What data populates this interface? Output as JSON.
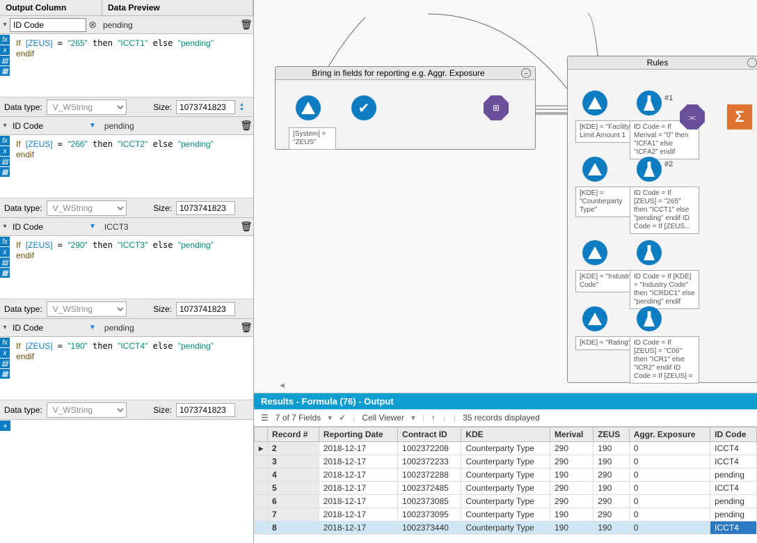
{
  "left": {
    "headers": {
      "a": "Output Column",
      "b": "Data Preview"
    },
    "blocks": [
      {
        "out": "ID Code",
        "preview": "pending",
        "zeus": "265",
        "icct": "ICCT1",
        "dt": "V_WString",
        "size": "1073741823",
        "clearX": true,
        "spin": true
      },
      {
        "out": "ID Code",
        "preview": "pending",
        "zeus": "266",
        "icct": "ICCT2",
        "dt": "V_WString",
        "size": "1073741823",
        "dd": true
      },
      {
        "out": "ID Code",
        "preview": "ICCT3",
        "zeus": "290",
        "icct": "ICCT3",
        "dt": "V_WString",
        "size": "1073741823",
        "dd": true
      },
      {
        "out": "ID Code",
        "preview": "pending",
        "zeus": "190",
        "icct": "ICCT4",
        "dt": "V_WString",
        "size": "1073741823",
        "dd": true
      }
    ],
    "labels": {
      "datatype": "Data type:",
      "size": "Size:"
    },
    "code": {
      "if": "If",
      "zeus": "[ZEUS]",
      "eq": " = ",
      "then": " then ",
      "else_": " else ",
      "pending": "\"pending\"",
      "endif": "endif"
    }
  },
  "canvas": {
    "box1": {
      "title": "Bring in fields for reporting e.g. Aggr. Exposure"
    },
    "box2": {
      "title": "Rules"
    },
    "annot_system": "[System] = \"ZEUS\"",
    "annots": [
      {
        "k": "[KDE] = \"Facility Limit Amount 1",
        "f": "ID Code = If Merival = \"0\" then \"ICFA1\" else \"ICFA2\" endif",
        "num": "#1"
      },
      {
        "k": "[KDE] = \"Counterparty Type\"",
        "f": "ID Code = If [ZEUS] = \"265\" then \"ICCT1\" else \"pending\" endif ID Code = If [ZEUS...",
        "num": "#2"
      },
      {
        "k": "[KDE] = \"Industry Code\"",
        "f": "ID Code = If [KDE] = \"Industry Code\" then \"ICRDC1\" else \"pending\" endif"
      },
      {
        "k": "[KDE] = \"Rating\"",
        "f": "ID Code = If [ZEUS] = \"C06\" then \"ICR1\" else \"ICR2\" endif ID Code = If [ZEUS] ="
      }
    ]
  },
  "results": {
    "title": "Results - Formula (76) - Output",
    "toolbar": {
      "fields": "7 of 7 Fields",
      "cell": "Cell Viewer",
      "records": "35 records displayed"
    },
    "cols": [
      "Record #",
      "Reporting Date",
      "Contract ID",
      "KDE",
      "Merival",
      "ZEUS",
      "Aggr. Exposure",
      "ID Code"
    ],
    "rows": [
      [
        "2",
        "2018-12-17",
        "1002372208",
        "Counterparty Type",
        "290",
        "190",
        "0",
        "ICCT4"
      ],
      [
        "3",
        "2018-12-17",
        "1002372233",
        "Counterparty Type",
        "290",
        "190",
        "0",
        "ICCT4"
      ],
      [
        "4",
        "2018-12-17",
        "1002372288",
        "Counterparty Type",
        "190",
        "290",
        "0",
        "pending"
      ],
      [
        "5",
        "2018-12-17",
        "1002372485",
        "Counterparty Type",
        "290",
        "190",
        "0",
        "ICCT4"
      ],
      [
        "6",
        "2018-12-17",
        "1002373085",
        "Counterparty Type",
        "290",
        "290",
        "0",
        "pending"
      ],
      [
        "7",
        "2018-12-17",
        "1002373095",
        "Counterparty Type",
        "190",
        "290",
        "0",
        "pending"
      ],
      [
        "8",
        "2018-12-17",
        "1002373440",
        "Counterparty Type",
        "190",
        "190",
        "0",
        "ICCT4"
      ]
    ]
  }
}
